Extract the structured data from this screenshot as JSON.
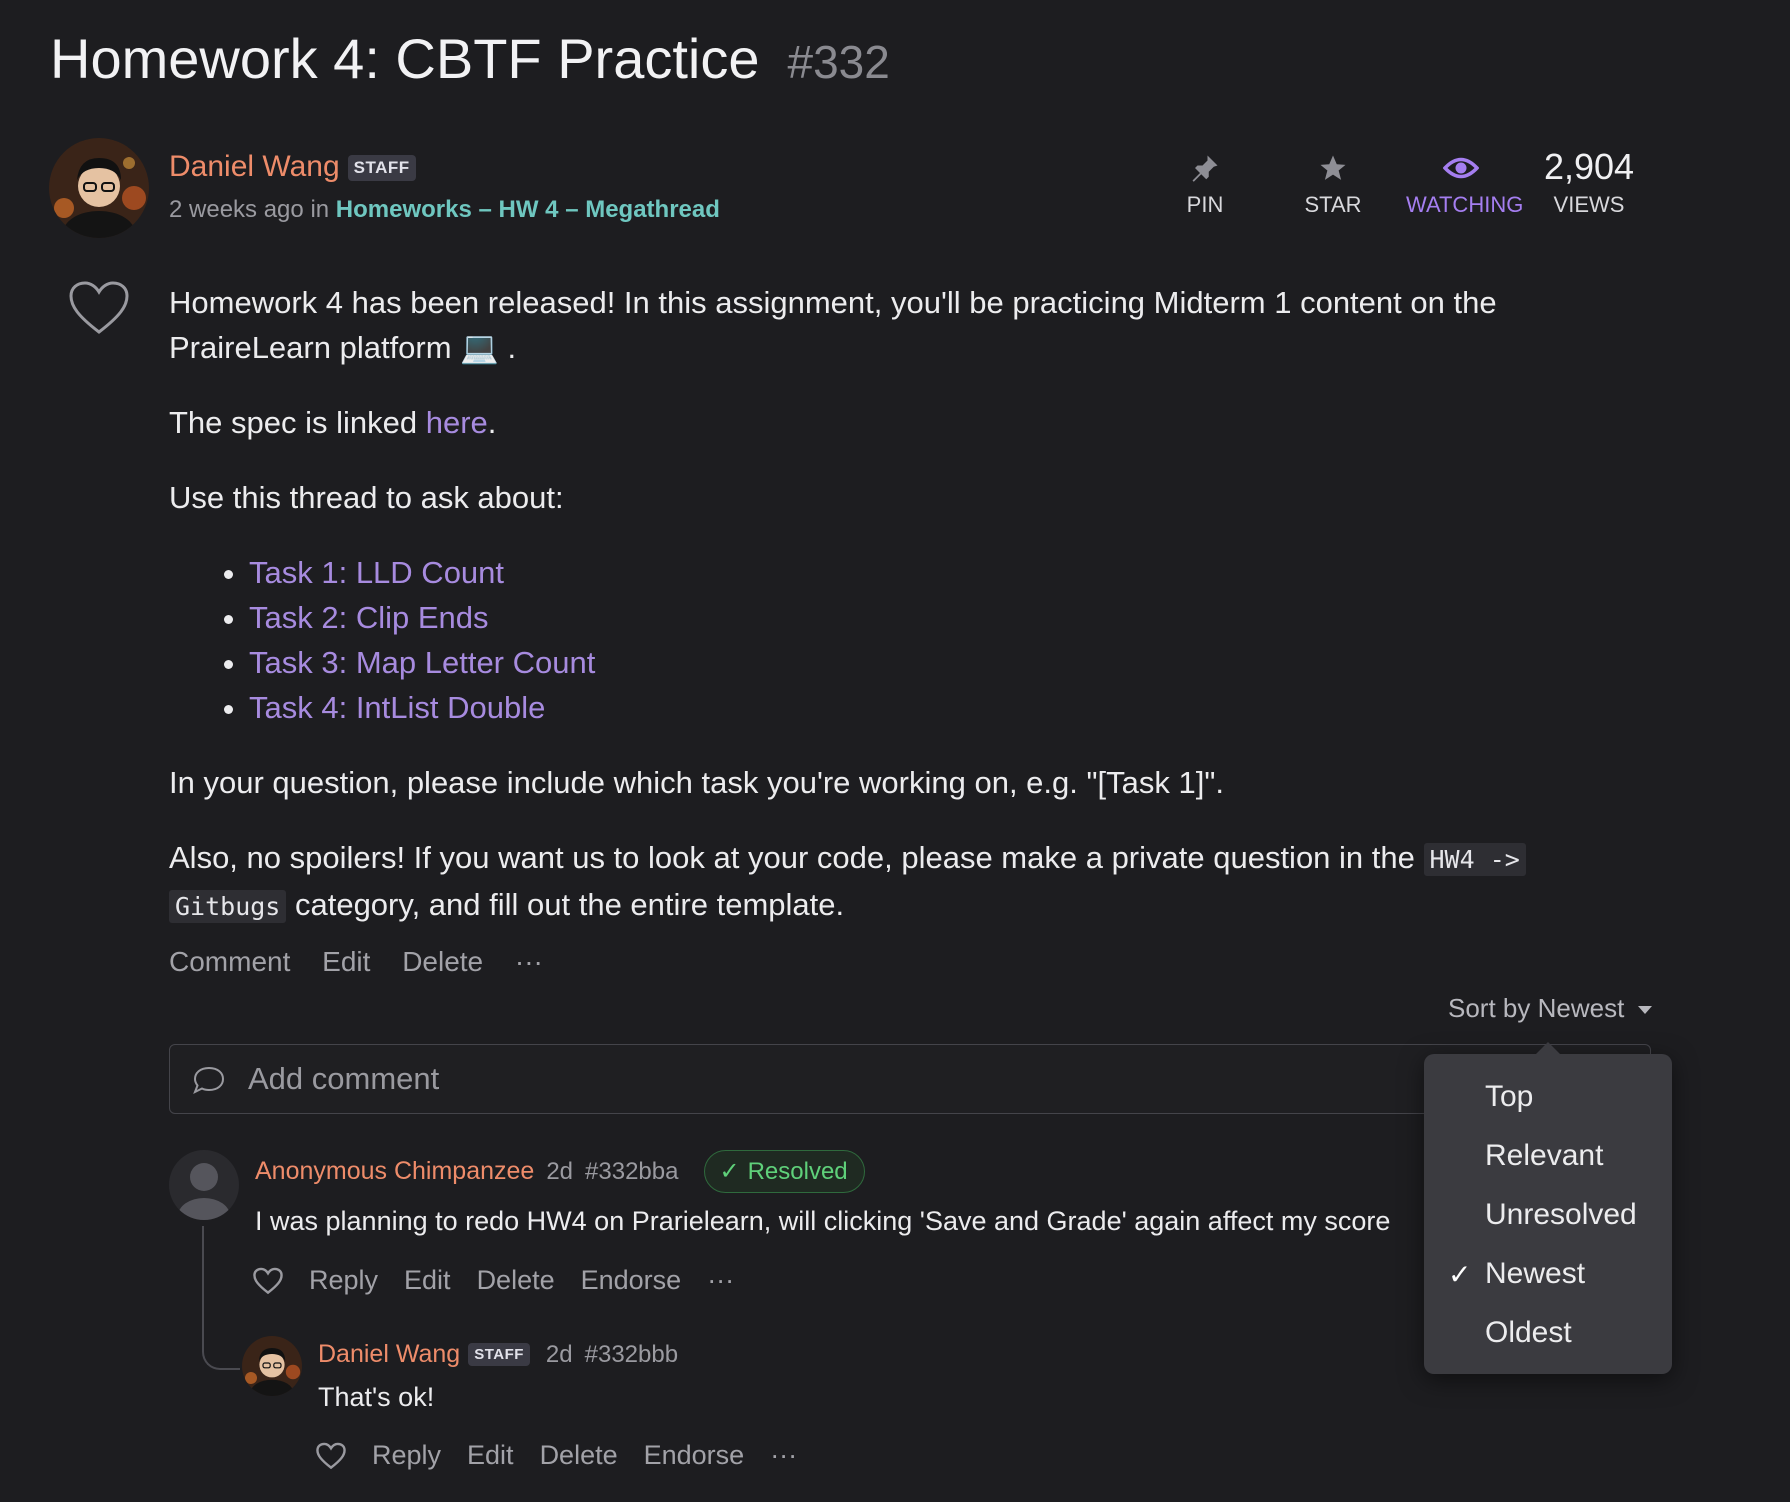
{
  "thread": {
    "title": "Homework 4: CBTF Practice",
    "number": "#332",
    "author": "Daniel Wang",
    "author_badge": "STAFF",
    "time": "2 weeks ago",
    "in_text": "in",
    "category": "Homeworks – HW 4 – Megathread"
  },
  "stats": {
    "pin": "PIN",
    "star": "STAR",
    "watching": "WATCHING",
    "views_count": "2,904",
    "views": "VIEWS"
  },
  "post": {
    "p1": "Homework 4 has been released! In this assignment, you'll be practicing Midterm 1 content on the PraireLearn platform",
    "p1_emoji": "💻",
    "p1_end": ".",
    "p2_before": "The spec is linked ",
    "p2_link": "here",
    "p2_after": ".",
    "p3": "Use this thread to ask about:",
    "tasks": [
      "Task 1: LLD Count",
      "Task 2: Clip Ends",
      "Task 3: Map Letter Count",
      "Task 4: IntList Double"
    ],
    "p4": "In your question, please include which task you're working on, e.g. \"[Task 1]\".",
    "p5_before": "Also, no spoilers! If you want us to look at your code, please make a private question in the ",
    "p5_code1": "HW4 ->",
    "p5_code2": "Gitbugs",
    "p5_after": " category, and fill out the entire template."
  },
  "post_actions": {
    "comment": "Comment",
    "edit": "Edit",
    "delete": "Delete",
    "more": "···"
  },
  "sort": {
    "label": "Sort by Newest"
  },
  "add_comment": {
    "placeholder": "Add comment"
  },
  "comment1": {
    "author": "Anonymous Chimpanzee",
    "time": "2d",
    "id": "#332bba",
    "status": "Resolved",
    "text": "I was planning to redo HW4 on Prarielearn, will clicking 'Save and Grade' again affect my score",
    "actions": {
      "reply": "Reply",
      "edit": "Edit",
      "delete": "Delete",
      "endorse": "Endorse",
      "more": "···"
    }
  },
  "reply1": {
    "author": "Daniel Wang",
    "badge": "STAFF",
    "time": "2d",
    "id": "#332bbb",
    "text": "That's ok!",
    "actions": {
      "reply": "Reply",
      "edit": "Edit",
      "delete": "Delete",
      "endorse": "Endorse",
      "more": "···"
    }
  },
  "sort_menu": {
    "items": [
      "Top",
      "Relevant",
      "Unresolved",
      "Newest",
      "Oldest"
    ],
    "selected": "Newest",
    "check": "✓"
  },
  "colors": {
    "background": "#1d1d20",
    "author": "#ee8c6a",
    "category": "#6fc7c0",
    "link": "#a78bdf",
    "watching": "#a57ef0",
    "resolved": "#5fd07a"
  }
}
